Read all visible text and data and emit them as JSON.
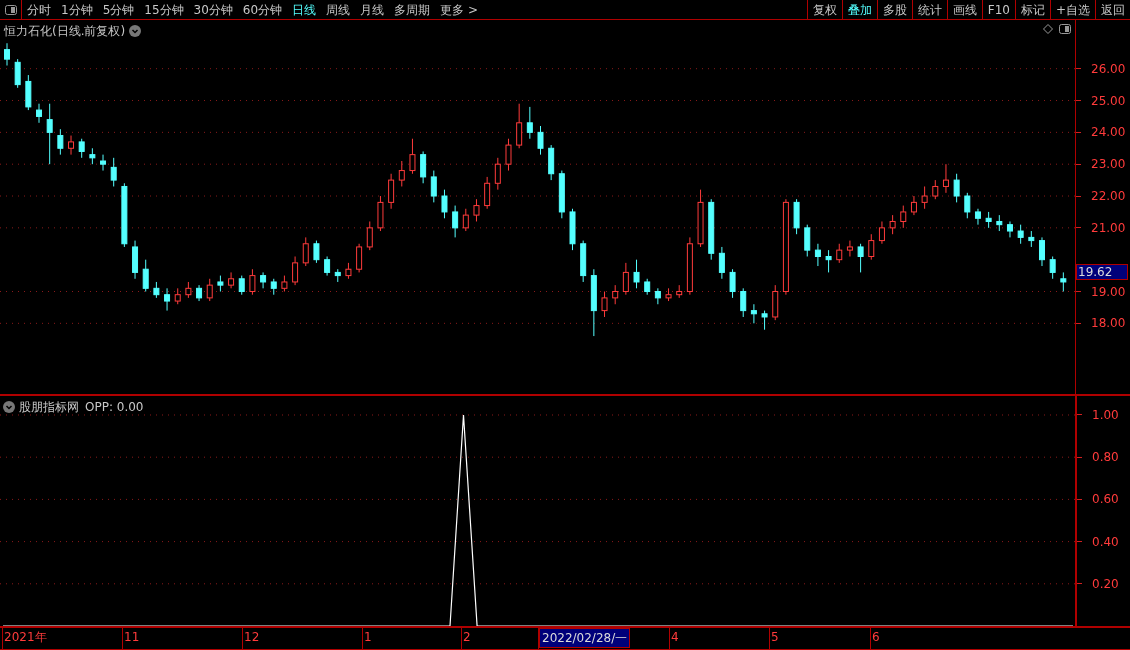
{
  "toolbar": {
    "periods": [
      {
        "label": "分时",
        "selected": false
      },
      {
        "label": "1分钟",
        "selected": false
      },
      {
        "label": "5分钟",
        "selected": false
      },
      {
        "label": "15分钟",
        "selected": false
      },
      {
        "label": "30分钟",
        "selected": false
      },
      {
        "label": "60分钟",
        "selected": false
      },
      {
        "label": "日线",
        "selected": true
      },
      {
        "label": "周线",
        "selected": false
      },
      {
        "label": "月线",
        "selected": false
      },
      {
        "label": "多周期",
        "selected": false
      },
      {
        "label": "更多 >",
        "selected": false
      }
    ],
    "actions": [
      {
        "label": "复权",
        "selected": false
      },
      {
        "label": "叠加",
        "selected": true
      },
      {
        "label": "多股",
        "selected": false
      },
      {
        "label": "统计",
        "selected": false
      },
      {
        "label": "画线",
        "selected": false
      },
      {
        "label": "F10",
        "selected": false
      },
      {
        "label": "标记",
        "selected": false
      },
      {
        "label": "+自选",
        "selected": false
      },
      {
        "label": "返回",
        "selected": false
      }
    ]
  },
  "price_panel": {
    "title": "恒力石化(日线.前复权)",
    "current_price": "19.62",
    "chart_data": {
      "type": "candlestick",
      "ylim": [
        15.78,
        27.53
      ],
      "yticks": [
        {
          "value": 26,
          "label": "26.00"
        },
        {
          "value": 25,
          "label": "25.00"
        },
        {
          "value": 24,
          "label": "24.00"
        },
        {
          "value": 23,
          "label": "23.00"
        },
        {
          "value": 22,
          "label": "22.00"
        },
        {
          "value": 21,
          "label": "21.00"
        },
        {
          "value": 19,
          "label": "19.00"
        },
        {
          "value": 18,
          "label": "18.00"
        }
      ],
      "grid": true,
      "ohlc": [
        [
          26.6,
          26.8,
          26.1,
          26.3
        ],
        [
          26.2,
          26.3,
          25.4,
          25.5
        ],
        [
          25.6,
          25.8,
          24.7,
          24.8
        ],
        [
          24.7,
          24.9,
          24.3,
          24.5
        ],
        [
          24.4,
          24.9,
          23.0,
          24.0
        ],
        [
          23.9,
          24.1,
          23.3,
          23.5
        ],
        [
          23.5,
          23.9,
          23.3,
          23.7
        ],
        [
          23.7,
          23.8,
          23.2,
          23.4
        ],
        [
          23.3,
          23.5,
          23.0,
          23.2
        ],
        [
          23.1,
          23.3,
          22.8,
          23.0
        ],
        [
          22.9,
          23.2,
          22.3,
          22.5
        ],
        [
          22.3,
          22.4,
          20.4,
          20.5
        ],
        [
          20.4,
          20.6,
          19.4,
          19.6
        ],
        [
          19.7,
          20.0,
          19.0,
          19.1
        ],
        [
          19.1,
          19.3,
          18.8,
          18.9
        ],
        [
          18.9,
          19.1,
          18.4,
          18.7
        ],
        [
          18.7,
          19.1,
          18.6,
          18.9
        ],
        [
          18.9,
          19.3,
          18.8,
          19.1
        ],
        [
          19.1,
          19.2,
          18.7,
          18.8
        ],
        [
          18.8,
          19.4,
          18.7,
          19.2
        ],
        [
          19.3,
          19.5,
          19.0,
          19.2
        ],
        [
          19.2,
          19.6,
          19.1,
          19.4
        ],
        [
          19.4,
          19.5,
          18.9,
          19.0
        ],
        [
          19.0,
          19.7,
          18.9,
          19.5
        ],
        [
          19.5,
          19.6,
          19.1,
          19.3
        ],
        [
          19.3,
          19.4,
          18.9,
          19.1
        ],
        [
          19.1,
          19.5,
          19.0,
          19.3
        ],
        [
          19.3,
          20.1,
          19.2,
          19.9
        ],
        [
          19.9,
          20.7,
          19.8,
          20.5
        ],
        [
          20.5,
          20.6,
          19.9,
          20.0
        ],
        [
          20.0,
          20.1,
          19.5,
          19.6
        ],
        [
          19.6,
          19.7,
          19.3,
          19.5
        ],
        [
          19.5,
          19.9,
          19.4,
          19.7
        ],
        [
          19.7,
          20.5,
          19.6,
          20.4
        ],
        [
          20.4,
          21.2,
          20.3,
          21.0
        ],
        [
          21.0,
          22.0,
          20.9,
          21.8
        ],
        [
          21.8,
          22.7,
          21.6,
          22.5
        ],
        [
          22.5,
          23.1,
          22.3,
          22.8
        ],
        [
          22.8,
          23.8,
          22.7,
          23.3
        ],
        [
          23.3,
          23.4,
          22.4,
          22.6
        ],
        [
          22.6,
          22.8,
          21.8,
          22.0
        ],
        [
          22.0,
          22.2,
          21.3,
          21.5
        ],
        [
          21.5,
          21.7,
          20.7,
          21.0
        ],
        [
          21.0,
          21.6,
          20.9,
          21.4
        ],
        [
          21.4,
          21.9,
          21.2,
          21.7
        ],
        [
          21.7,
          22.6,
          21.6,
          22.4
        ],
        [
          22.4,
          23.2,
          22.2,
          23.0
        ],
        [
          23.0,
          23.8,
          22.8,
          23.6
        ],
        [
          23.6,
          24.9,
          23.5,
          24.3
        ],
        [
          24.3,
          24.8,
          23.8,
          24.0
        ],
        [
          24.0,
          24.2,
          23.3,
          23.5
        ],
        [
          23.5,
          23.6,
          22.5,
          22.7
        ],
        [
          22.7,
          22.8,
          21.3,
          21.5
        ],
        [
          21.5,
          21.6,
          20.3,
          20.5
        ],
        [
          20.5,
          20.6,
          19.3,
          19.5
        ],
        [
          19.5,
          19.7,
          17.6,
          18.4
        ],
        [
          18.4,
          19.0,
          18.2,
          18.8
        ],
        [
          18.8,
          19.2,
          18.6,
          19.0
        ],
        [
          19.0,
          19.9,
          18.9,
          19.6
        ],
        [
          19.6,
          20.0,
          19.1,
          19.3
        ],
        [
          19.3,
          19.4,
          18.9,
          19.0
        ],
        [
          19.0,
          19.1,
          18.6,
          18.8
        ],
        [
          18.8,
          19.1,
          18.7,
          18.9
        ],
        [
          18.9,
          19.2,
          18.8,
          19.0
        ],
        [
          19.0,
          20.7,
          18.9,
          20.5
        ],
        [
          20.5,
          22.2,
          20.4,
          21.8
        ],
        [
          21.8,
          21.9,
          20.0,
          20.2
        ],
        [
          20.2,
          20.4,
          19.4,
          19.6
        ],
        [
          19.6,
          19.7,
          18.8,
          19.0
        ],
        [
          19.0,
          19.1,
          18.2,
          18.4
        ],
        [
          18.4,
          18.6,
          18.0,
          18.3
        ],
        [
          18.3,
          18.4,
          17.8,
          18.2
        ],
        [
          18.2,
          19.2,
          18.1,
          19.0
        ],
        [
          19.0,
          21.9,
          18.9,
          21.8
        ],
        [
          21.8,
          21.9,
          20.8,
          21.0
        ],
        [
          21.0,
          21.1,
          20.1,
          20.3
        ],
        [
          20.3,
          20.5,
          19.8,
          20.1
        ],
        [
          20.1,
          20.3,
          19.6,
          20.0
        ],
        [
          20.0,
          20.5,
          19.9,
          20.3
        ],
        [
          20.3,
          20.6,
          20.1,
          20.4
        ],
        [
          20.4,
          20.5,
          19.6,
          20.1
        ],
        [
          20.1,
          20.8,
          20.0,
          20.6
        ],
        [
          20.6,
          21.2,
          20.5,
          21.0
        ],
        [
          21.0,
          21.4,
          20.8,
          21.2
        ],
        [
          21.2,
          21.7,
          21.0,
          21.5
        ],
        [
          21.5,
          22.0,
          21.4,
          21.8
        ],
        [
          21.8,
          22.3,
          21.6,
          22.0
        ],
        [
          22.0,
          22.5,
          21.9,
          22.3
        ],
        [
          22.3,
          23.0,
          22.1,
          22.5
        ],
        [
          22.5,
          22.7,
          21.8,
          22.0
        ],
        [
          22.0,
          22.1,
          21.3,
          21.5
        ],
        [
          21.5,
          21.6,
          21.1,
          21.3
        ],
        [
          21.3,
          21.5,
          21.0,
          21.2
        ],
        [
          21.2,
          21.4,
          20.9,
          21.1
        ],
        [
          21.1,
          21.2,
          20.7,
          20.9
        ],
        [
          20.9,
          21.1,
          20.5,
          20.7
        ],
        [
          20.7,
          20.9,
          20.4,
          20.6
        ],
        [
          20.6,
          20.7,
          19.8,
          20.0
        ],
        [
          20.0,
          20.1,
          19.4,
          19.6
        ],
        [
          19.4,
          19.6,
          19.0,
          19.3
        ]
      ]
    }
  },
  "indicator_panel": {
    "title": "股朋指标网",
    "reading": ": 0.00",
    "chart_data": {
      "type": "line",
      "grid": true,
      "ylim": [
        0,
        1.09
      ],
      "yticks": [
        {
          "value": 1,
          "label": "1.00"
        },
        {
          "value": 0.8,
          "label": "0.80"
        },
        {
          "value": 0.6,
          "label": "0.60"
        },
        {
          "value": 0.4,
          "label": "0.40"
        },
        {
          "value": 0.2,
          "label": "0.20"
        }
      ],
      "series": [
        {
          "name": "OPP",
          "color": "#ffffff",
          "values": [
            0,
            0,
            0,
            0,
            0,
            0,
            0,
            0,
            0,
            0,
            0,
            0,
            0,
            0,
            0,
            0,
            0,
            0,
            0,
            0,
            0,
            0,
            0,
            0,
            0,
            0,
            0,
            0,
            0,
            0,
            0,
            0,
            0,
            0,
            1,
            0,
            0,
            0,
            0,
            0,
            0,
            0,
            0,
            0,
            0,
            0,
            0,
            0,
            0,
            0,
            0,
            0,
            0,
            0,
            0,
            0,
            0,
            0,
            0,
            0,
            0,
            0,
            0,
            0,
            0,
            0,
            0,
            0,
            0,
            0,
            0,
            0,
            0,
            0,
            0,
            0,
            0,
            0,
            0,
            0
          ]
        }
      ]
    }
  },
  "time_axis": [
    {
      "label": "2021年",
      "kind": "tick"
    },
    {
      "label": "11",
      "kind": "tick"
    },
    {
      "label": "12",
      "kind": "tick"
    },
    {
      "label": "1",
      "kind": "tick"
    },
    {
      "label": "2",
      "kind": "tick"
    },
    {
      "label": "2022/02/28/一",
      "kind": "cursor"
    },
    {
      "label": "4",
      "kind": "tick"
    },
    {
      "label": "5",
      "kind": "tick"
    },
    {
      "label": "6",
      "kind": "tick"
    }
  ]
}
